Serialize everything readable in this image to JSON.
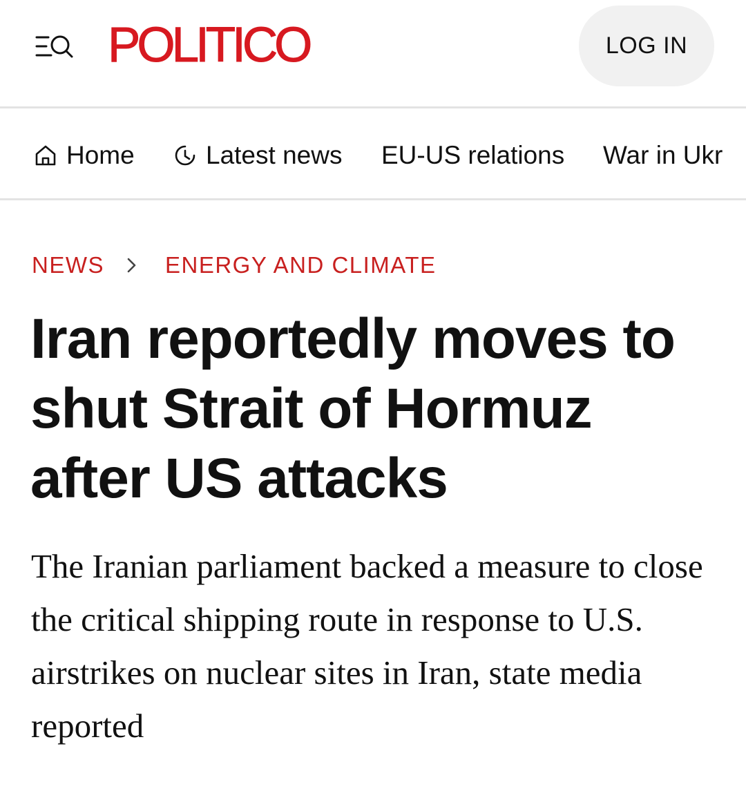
{
  "header": {
    "menu_icon": "menu-search-icon",
    "logo_text": "POLITICO",
    "login_label": "LOG IN",
    "brand_color": "#d71920"
  },
  "nav": {
    "items": [
      {
        "label": "Home",
        "icon": "home-icon"
      },
      {
        "label": "Latest news",
        "icon": "clock-icon"
      },
      {
        "label": "EU-US relations"
      },
      {
        "label": "War in Ukr"
      }
    ]
  },
  "breadcrumb": {
    "section": "NEWS",
    "separator_icon": "chevron-right-icon",
    "subsection": "ENERGY AND CLIMATE",
    "color": "#c8201f"
  },
  "article": {
    "headline": "Iran reportedly moves to shut Strait of Hormuz after US attacks",
    "dek": "The Iranian parliament backed a measure to close the critical shipping route in response to U.S. airstrikes on nuclear sites in Iran, state media reported"
  }
}
